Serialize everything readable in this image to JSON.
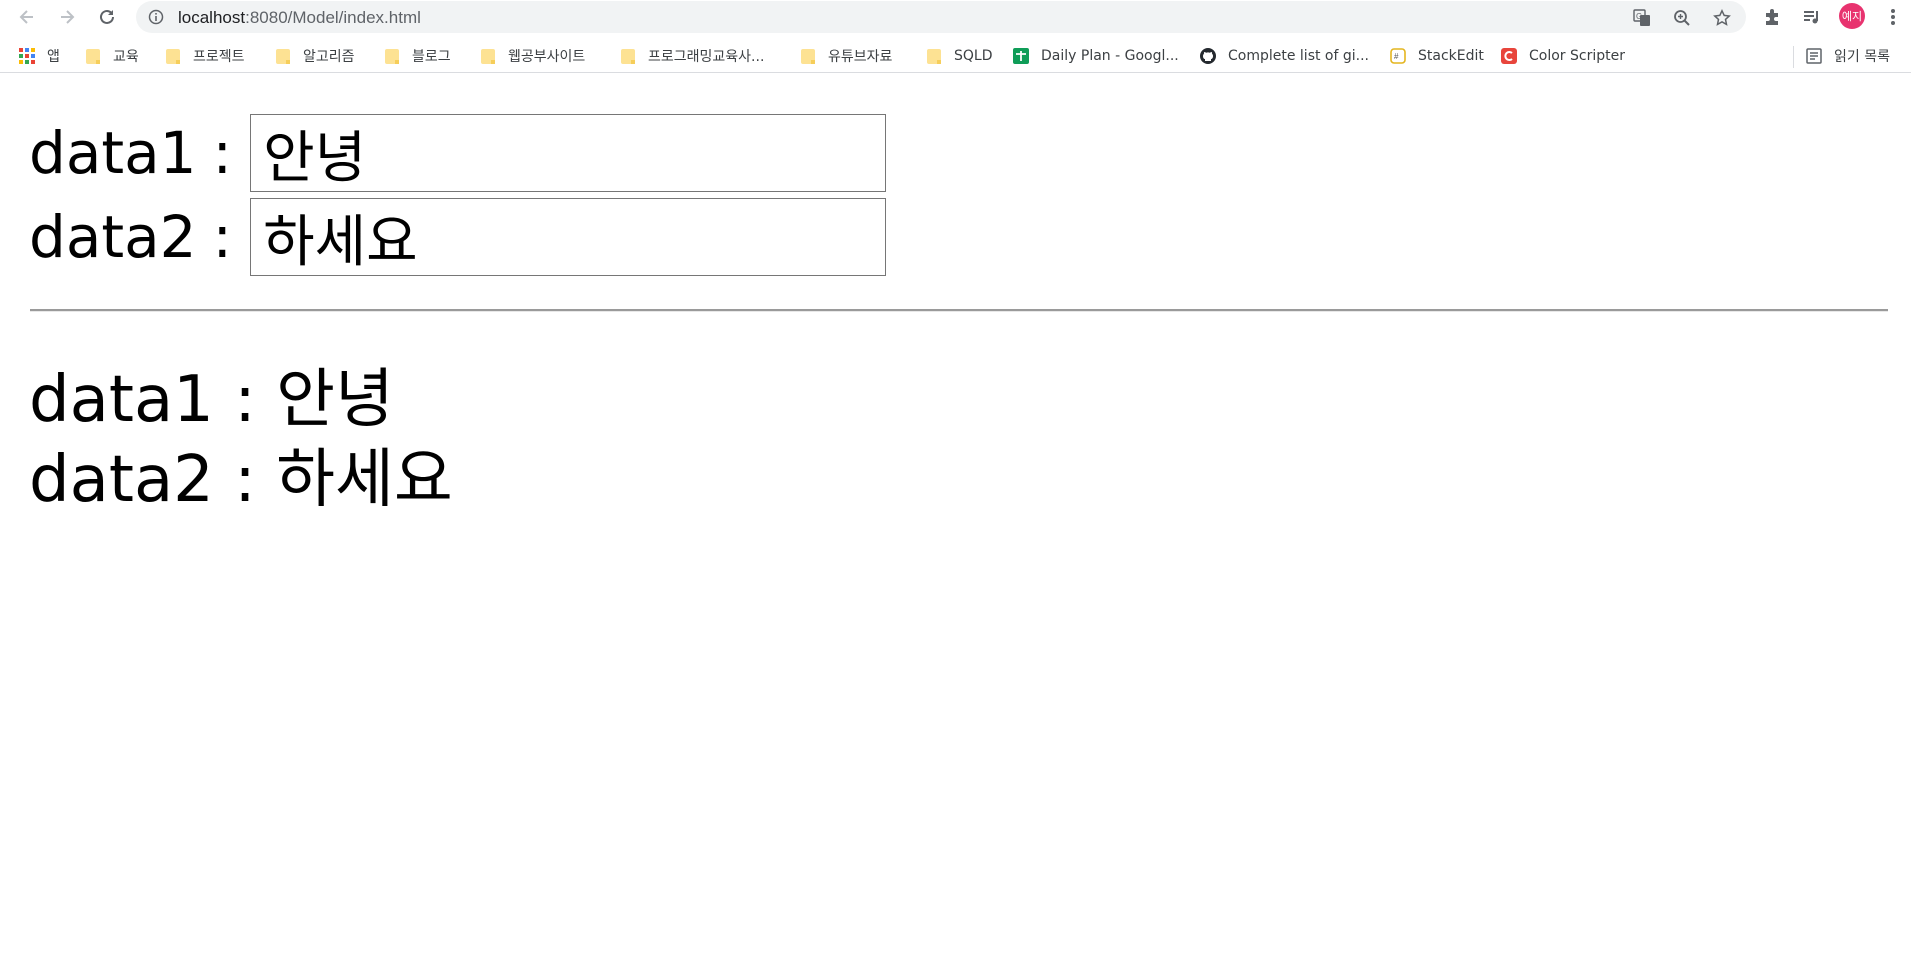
{
  "browser": {
    "url_host": "localhost",
    "url_rest": ":8080/Model/index.html",
    "avatar_text": "예지",
    "bookmarks": [
      {
        "label": "앱",
        "icon": "apps-grid-icon"
      },
      {
        "label": "교육",
        "icon": "folder-icon"
      },
      {
        "label": "프로젝트",
        "icon": "folder-icon"
      },
      {
        "label": "알고리즘",
        "icon": "folder-icon"
      },
      {
        "label": "블로그",
        "icon": "folder-icon"
      },
      {
        "label": "웹공부사이트",
        "icon": "folder-icon"
      },
      {
        "label": "프로그래밍교육사...",
        "icon": "folder-icon"
      },
      {
        "label": "유튜브자료",
        "icon": "folder-icon"
      },
      {
        "label": "SQLD",
        "icon": "folder-icon"
      },
      {
        "label": "Daily Plan - Googl...",
        "icon": "google-sheets-icon"
      },
      {
        "label": "Complete list of gi...",
        "icon": "github-icon"
      },
      {
        "label": "StackEdit",
        "icon": "stackedit-icon"
      },
      {
        "label": "Color Scripter",
        "icon": "color-scripter-icon"
      }
    ],
    "reading_list": "읽기 목록"
  },
  "form": {
    "data1_label": "data1",
    "data2_label": "data2",
    "colon": ":",
    "data1_value": "안녕",
    "data2_value": "하세요"
  },
  "output": {
    "line1": "data1 : 안녕",
    "line2": "data2 : 하세요"
  }
}
